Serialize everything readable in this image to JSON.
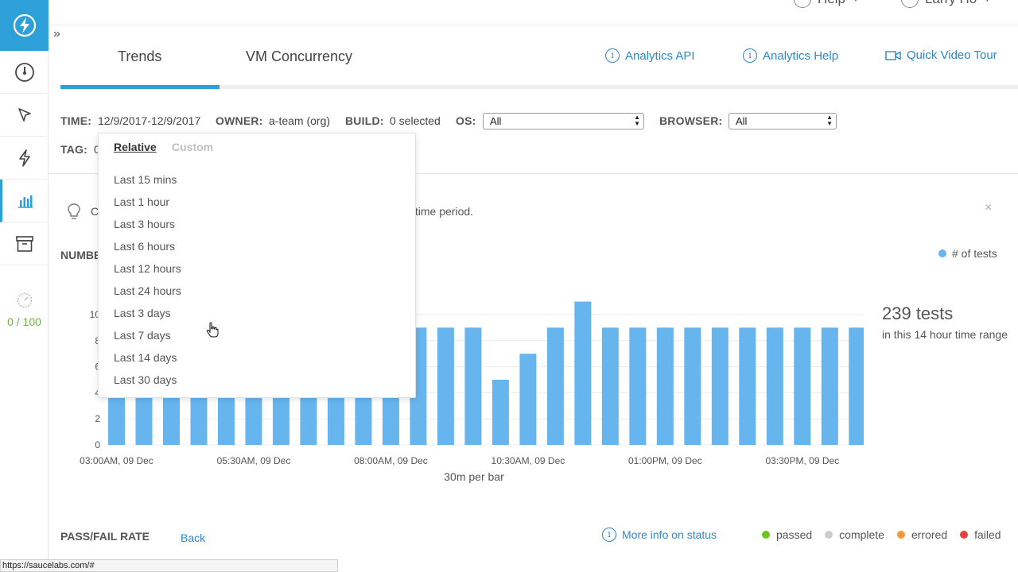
{
  "colors": {
    "accent": "#2d9fd9",
    "bar": "#66b5ef",
    "link": "#2d87c8",
    "passed": "#6cc51f",
    "complete": "#cccccc",
    "errored": "#f39a3b",
    "failed": "#e84040"
  },
  "top_bar": {
    "help_label": "Help",
    "user_name": "Larry Ho"
  },
  "sidebar": {
    "items": [
      {
        "icon": "dashboard-gauge-icon"
      },
      {
        "icon": "pointer-icon"
      },
      {
        "icon": "lightning-icon"
      },
      {
        "icon": "analytics-bar-chart-icon"
      },
      {
        "icon": "archive-icon"
      }
    ],
    "concurrency_value": "0 / 100"
  },
  "tabs": [
    {
      "label": "Trends"
    },
    {
      "label": "VM Concurrency"
    }
  ],
  "links": {
    "api": "Analytics API",
    "help": "Analytics Help",
    "video": "Quick Video Tour"
  },
  "filters": {
    "time_label": "TIME:",
    "time_value": "12/9/2017-12/9/2017",
    "owner_label": "OWNER:",
    "owner_value": "a-team (org)",
    "build_label": "BUILD:",
    "build_value": "0 selected",
    "os_label": "OS:",
    "os_value": "All",
    "browser_label": "BROWSER:",
    "browser_value": "All",
    "tag_label": "TAG:",
    "tag_value": "0"
  },
  "tip": {
    "text_start": "C",
    "text_end": "fic time period."
  },
  "time_dropdown": {
    "tab_relative": "Relative",
    "tab_custom": "Custom",
    "options": [
      "Last 15 mins",
      "Last 1 hour",
      "Last 3 hours",
      "Last 6 hours",
      "Last 12 hours",
      "Last 24 hours",
      "Last 3 days",
      "Last 7 days",
      "Last 14 days",
      "Last 30 days"
    ]
  },
  "chart_title": "NUMBE",
  "chart_data": {
    "type": "bar",
    "x": [
      "03:00AM",
      "03:30AM",
      "04:00AM",
      "04:30AM",
      "05:00AM",
      "05:30AM",
      "06:00AM",
      "06:30AM",
      "07:00AM",
      "07:30AM",
      "08:00AM",
      "08:30AM",
      "09:00AM",
      "09:30AM",
      "10:00AM",
      "10:30AM",
      "11:00AM",
      "11:30AM",
      "12:00PM",
      "12:30PM",
      "01:00PM",
      "01:30PM",
      "02:00PM",
      "02:30PM",
      "03:00PM",
      "03:30PM",
      "04:00PM",
      "04:30PM"
    ],
    "series": [
      {
        "name": "# of tests",
        "values": [
          9,
          9,
          9,
          9,
          9,
          9,
          9,
          9,
          9,
          9,
          9,
          9,
          9,
          9,
          5,
          7,
          9,
          11,
          9,
          9,
          9,
          9,
          9,
          9,
          9,
          9,
          9,
          9
        ]
      }
    ],
    "x_ticks": [
      "03:00AM, 09 Dec",
      "05:30AM, 09 Dec",
      "08:00AM, 09 Dec",
      "10:30AM, 09 Dec",
      "01:00PM, 09 Dec",
      "03:30PM, 09 Dec"
    ],
    "y_ticks": [
      0,
      2,
      4,
      6,
      8,
      10
    ],
    "ylim": [
      0,
      12
    ],
    "xlabel": "30m per bar",
    "legend": "top-right",
    "grid": true
  },
  "summary": {
    "count": "239 tests",
    "range": "in this 14 hour time range"
  },
  "pass_fail": {
    "title": "PASS/FAIL RATE",
    "back": "Back",
    "more_info": "More info on status",
    "legend": [
      "passed",
      "complete",
      "errored",
      "failed"
    ]
  },
  "status_url": "https://saucelabs.com/#"
}
